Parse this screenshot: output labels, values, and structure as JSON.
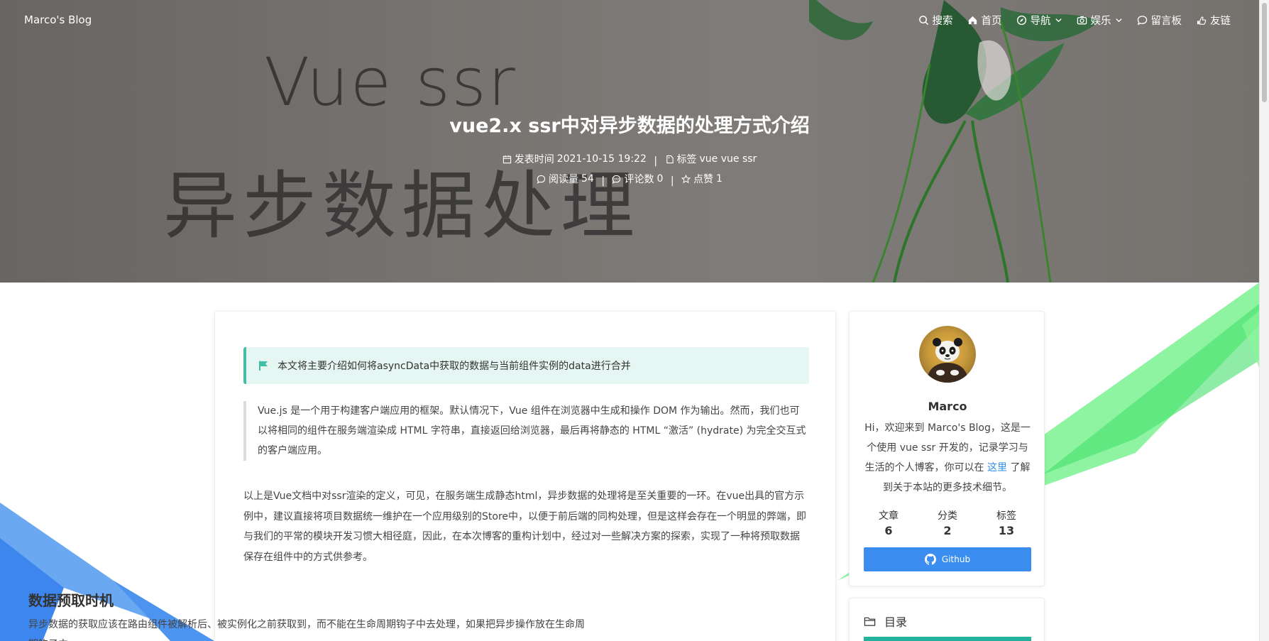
{
  "brand": "Marco's Blog",
  "nav": {
    "items": [
      {
        "label": "搜索",
        "icon": "search-icon"
      },
      {
        "label": "首页",
        "icon": "home-icon"
      },
      {
        "label": "导航",
        "icon": "compass-icon",
        "dropdown": true
      },
      {
        "label": "娱乐",
        "icon": "camera-icon",
        "dropdown": true
      },
      {
        "label": "留言板",
        "icon": "chat-icon"
      },
      {
        "label": "友链",
        "icon": "link-icon"
      }
    ]
  },
  "hero": {
    "art_line1": "Vue ssr",
    "art_line2": "异步数据处理",
    "title": "vue2.x ssr中对异步数据的处理方式介绍",
    "publish_label": "发表时间",
    "publish_time": "2021-10-15 19:22",
    "tags_label": "标签",
    "tags": "vue vue ssr",
    "views_label": "阅读量",
    "views": "54",
    "comments_label": "评论数",
    "comments": "0",
    "likes_label": "点赞",
    "likes": "1"
  },
  "article": {
    "notice": "本文将主要介绍如何将asyncData中获取的数据与当前组件实例的data进行合并",
    "quote": "Vue.js 是一个用于构建客户端应用的框架。默认情况下，Vue 组件在浏览器中生成和操作 DOM 作为输出。然而，我们也可以将相同的组件在服务端渲染成 HTML 字符串，直接返回给浏览器，最后再将静态的 HTML “激活” (hydrate) 为完全交互式的客户端应用。",
    "para1": "以上是Vue文档中对ssr渲染的定义，可见，在服务端生成静态html，异步数据的处理将是至关重要的一环。在vue出具的官方示例中，建议直接将项目数据统一维护在一个应用级别的Store中，以便于前后端的同构处理，但是这样会存在一个明显的弊端，即与我们的平常的模块开发习惯大相径庭，因此，在本次博客的重构计划中，经过对一些解决方案的探索，实现了一种将预取数据保存在组件中的方式供参考。",
    "heading": "数据预取时机",
    "para2": "异步数据的获取应该在路由组件被解析后、被实例化之前获取到，而不能在生命周期钩子中去处理，如果把异步操作放在生命周期钩子中"
  },
  "profile": {
    "name": "Marco",
    "desc_before": "Hi，欢迎来到 Marco's Blog，这是一个使用 vue ssr 开发的，记录学习与生活的个人博客，你可以在",
    "desc_link": "这里",
    "desc_after": "了解到关于本站的更多技术细节。",
    "stats": [
      {
        "label": "文章",
        "value": "6"
      },
      {
        "label": "分类",
        "value": "2"
      },
      {
        "label": "标签",
        "value": "13"
      }
    ],
    "github_label": "Github"
  },
  "toc": {
    "title": "目录"
  },
  "colors": {
    "accent": "#3b8ef0",
    "notice_bg": "#e6f6f2",
    "notice_border": "#3fbfa4",
    "toc_bar": "#23b39c"
  }
}
